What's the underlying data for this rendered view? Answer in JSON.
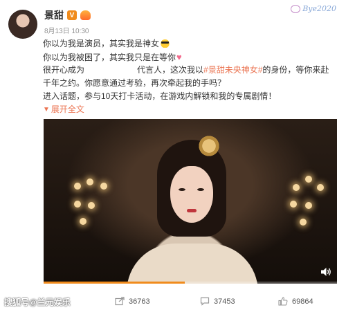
{
  "post": {
    "username": "景甜",
    "badge_v": "V",
    "time": "8月13日 10:30",
    "lines": {
      "l1": "你以为我是演员，其实我是神女",
      "l2": "你以为我被困了，其实我只是在等你",
      "l3_a": "很开心成为",
      "l3_b": "代言人，这次我以",
      "l3_topic": "#景甜未央神女#",
      "l3_c": "的身份，等你来赴",
      "l4": "千年之约。你愿意通过考验，再次牵起我的手吗？",
      "l5": "进入话题，参与10天打卡活动，在游戏内解锁和我的专属剧情！"
    },
    "expand_label": "展开全文",
    "expand_icon": "chevron-down-icon"
  },
  "video": {
    "progress": 0.48,
    "volume_icon": "speaker-icon"
  },
  "stats": {
    "reposts": "36763",
    "comments": "37453",
    "likes": "69864"
  },
  "watermarks": {
    "top_right": "Bye2020",
    "bottom_left": "搜狐号@兰元娱乐"
  },
  "colors": {
    "accent": "#eb7350",
    "vip_badge": "#f08b1c",
    "text": "#333333",
    "meta": "#939393"
  }
}
